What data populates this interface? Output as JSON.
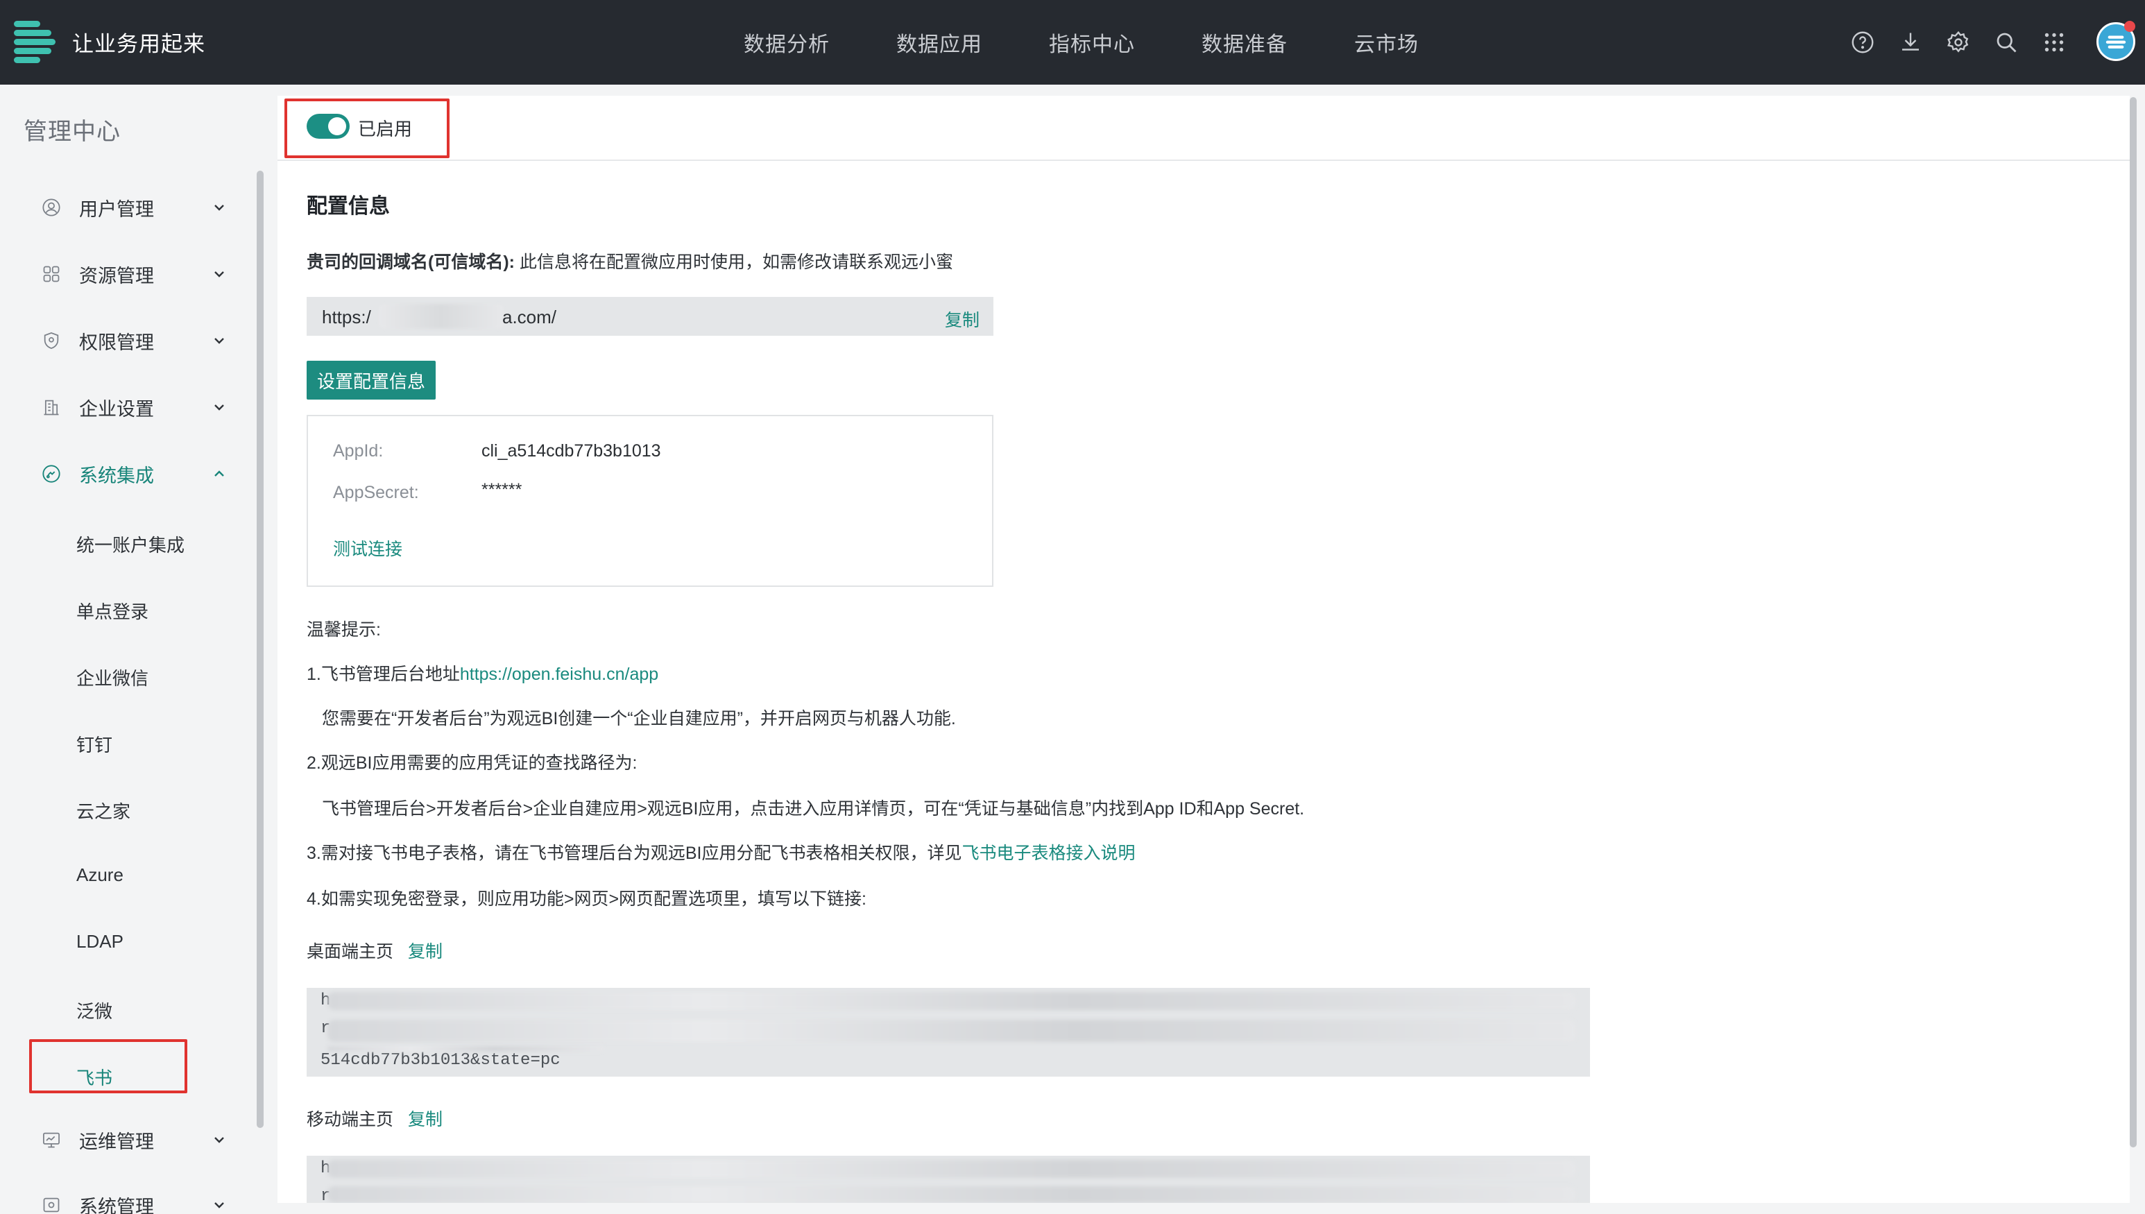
{
  "app": {
    "title": "让业务用起来"
  },
  "nav": {
    "items": [
      {
        "label": "数据分析"
      },
      {
        "label": "数据应用"
      },
      {
        "label": "指标中心"
      },
      {
        "label": "数据准备"
      },
      {
        "label": "云市场"
      }
    ]
  },
  "top_icons": [
    "help-icon",
    "download-icon",
    "settings-icon",
    "search-icon",
    "apps-grid-icon"
  ],
  "sidebar": {
    "title": "管理中心",
    "groups": [
      {
        "label": "用户管理",
        "icon": "user-icon"
      },
      {
        "label": "资源管理",
        "icon": "resource-icon"
      },
      {
        "label": "权限管理",
        "icon": "shield-icon"
      },
      {
        "label": "企业设置",
        "icon": "building-icon"
      },
      {
        "label": "系统集成",
        "icon": "integration-icon"
      },
      {
        "label": "运维管理",
        "icon": "monitor-icon"
      },
      {
        "label": "系统管理",
        "icon": "system-icon"
      }
    ],
    "sub_items": [
      {
        "label": "统一账户集成"
      },
      {
        "label": "单点登录"
      },
      {
        "label": "企业微信"
      },
      {
        "label": "钉钉"
      },
      {
        "label": "云之家"
      },
      {
        "label": "Azure"
      },
      {
        "label": "LDAP"
      },
      {
        "label": "泛微"
      },
      {
        "label": "飞书"
      }
    ]
  },
  "main": {
    "toggle_label": "已启用",
    "section_title": "配置信息",
    "domain_label": "贵司的回调域名(可信域名):",
    "domain_desc": "此信息将在配置微应用时使用，如需修改请联系观远小蜜",
    "url_prefix": "https:/",
    "url_suffix": "a.com/",
    "copy_label": "复制",
    "set_config_button": "设置配置信息",
    "config": {
      "appid_label": "AppId:",
      "appid_value": "cli_a514cdb77b3b1013",
      "secret_label": "AppSecret:",
      "secret_value": "******",
      "test_link": "测试连接"
    },
    "tips": {
      "heading": "温馨提示:",
      "line1_prefix": "1.飞书管理后台地址",
      "line1_link": "https://open.feishu.cn/app",
      "line1_detail": "您需要在“开发者后台”为观远BI创建一个“企业自建应用”，并开启网页与机器人功能.",
      "line2": "2.观远BI应用需要的应用凭证的查找路径为:",
      "line2_detail": "飞书管理后台>开发者后台>企业自建应用>观远BI应用，点击进入应用详情页，可在“凭证与基础信息”内找到App ID和App Secret.",
      "line3_prefix": "3.需对接飞书电子表格，请在飞书管理后台为观远BI应用分配飞书表格相关权限，详见",
      "line3_link": "飞书电子表格接入说明",
      "line4": "4.如需实现免密登录，则应用功能>网页>网页配置选项里，填写以下链接:"
    },
    "desktop_label": "桌面端主页",
    "mobile_label": "移动端主页",
    "desktop_code_line1": "h",
    "desktop_code_line2": "r",
    "desktop_code_line3": "514cdb77b3b1013&state=pc",
    "mobile_code_line1": "h",
    "mobile_code_line2": "r"
  },
  "colors": {
    "accent": "#1d8c80",
    "topbar": "#262a30",
    "highlight": "#e0332f"
  }
}
